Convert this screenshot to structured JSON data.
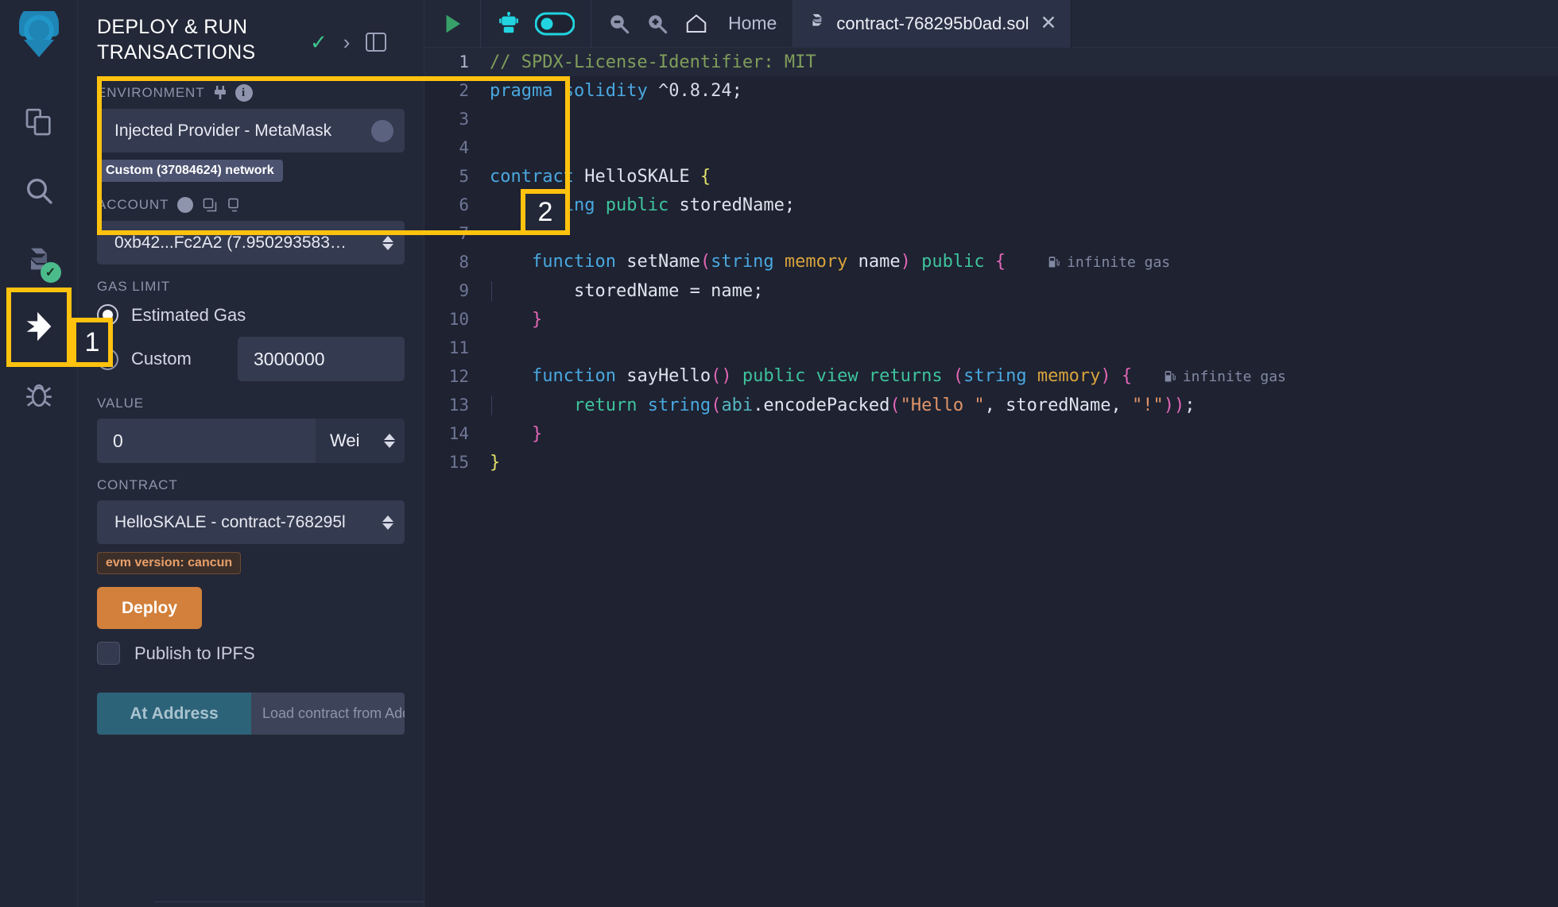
{
  "rail": {
    "logo_name": "remix-logo",
    "items": [
      {
        "name": "file-explorer-icon",
        "label": "File explorer"
      },
      {
        "name": "search-icon",
        "label": "Search in files"
      },
      {
        "name": "solidity-compiler-icon",
        "label": "Solidity compiler",
        "status": "compiled-ok"
      },
      {
        "name": "deploy-run-icon",
        "label": "Deploy & run transactions",
        "active": true
      },
      {
        "name": "debugger-icon",
        "label": "Debugger"
      }
    ]
  },
  "panel": {
    "title": "DEPLOY & RUN TRANSACTIONS",
    "header_icons": {
      "check": "✓",
      "chevron": "›",
      "layout": "layout-icon"
    },
    "environment": {
      "label": "ENVIRONMENT",
      "plug_icon": "plug-icon",
      "info_icon": "info-icon",
      "value": "Injected Provider - MetaMask",
      "network_badge": "Custom (37084624) network"
    },
    "account": {
      "label": "ACCOUNT",
      "value": "0xb42...Fc2A2 (7.950293583…",
      "icons": [
        "account-avatar-icon",
        "copy-icon",
        "sign-icon"
      ]
    },
    "gas_limit": {
      "label": "GAS LIMIT",
      "estimated_label": "Estimated Gas",
      "estimated_selected": true,
      "custom_label": "Custom",
      "custom_value": "3000000"
    },
    "value": {
      "label": "VALUE",
      "amount": "0",
      "unit": "Wei"
    },
    "contract": {
      "label": "CONTRACT",
      "value": "HelloSKALE - contract-768295l",
      "evm_badge": "evm version: cancun"
    },
    "deploy_label": "Deploy",
    "publish_ipfs_label": "Publish to IPFS",
    "publish_ipfs_checked": false,
    "at_address_label": "At Address",
    "at_address_placeholder": "Load contract from Address"
  },
  "toolbar": {
    "run_icon": "play-icon",
    "ai_icon": "robot-icon",
    "ai_toggle_on": true,
    "zoom_out_icon": "zoom-out-icon",
    "zoom_in_icon": "zoom-in-icon",
    "home_icon": "home-icon",
    "home_label": "Home"
  },
  "tabs": [
    {
      "icon": "solidity-file-icon",
      "label": "contract-768295b0ad.sol",
      "close": "✕",
      "active": true
    }
  ],
  "editor": {
    "language": "solidity",
    "lines": [
      {
        "n": 1,
        "text": "// SPDX-License-Identifier: MIT"
      },
      {
        "n": 2,
        "text": "pragma solidity ^0.8.24;"
      },
      {
        "n": 3,
        "text": ""
      },
      {
        "n": 4,
        "text": ""
      },
      {
        "n": 5,
        "text": "contract HelloSKALE {"
      },
      {
        "n": 6,
        "text": "    string public storedName;"
      },
      {
        "n": 7,
        "text": ""
      },
      {
        "n": 8,
        "text": "    function setName(string memory name) public {",
        "gas": "infinite gas"
      },
      {
        "n": 9,
        "text": "        storedName = name;"
      },
      {
        "n": 10,
        "text": "    }"
      },
      {
        "n": 11,
        "text": ""
      },
      {
        "n": 12,
        "text": "    function sayHello() public view returns (string memory) {",
        "gas": "infinite gas"
      },
      {
        "n": 13,
        "text": "        return string(abi.encodePacked(\"Hello \", storedName, \"!\"));"
      },
      {
        "n": 14,
        "text": "    }"
      },
      {
        "n": 15,
        "text": "}"
      }
    ],
    "gas_note_icon": "gas-pump-icon"
  },
  "annotations": [
    {
      "id": "1",
      "target": "deploy-run-icon"
    },
    {
      "id": "2",
      "target": "environment-section"
    }
  ],
  "colors": {
    "highlight": "#ffc20e",
    "deploy": "#d2803b",
    "at_address": "#2d6379",
    "accent_teal": "#3bbfa4",
    "panel_bg": "#232838",
    "editor_bg": "#1e2231"
  }
}
